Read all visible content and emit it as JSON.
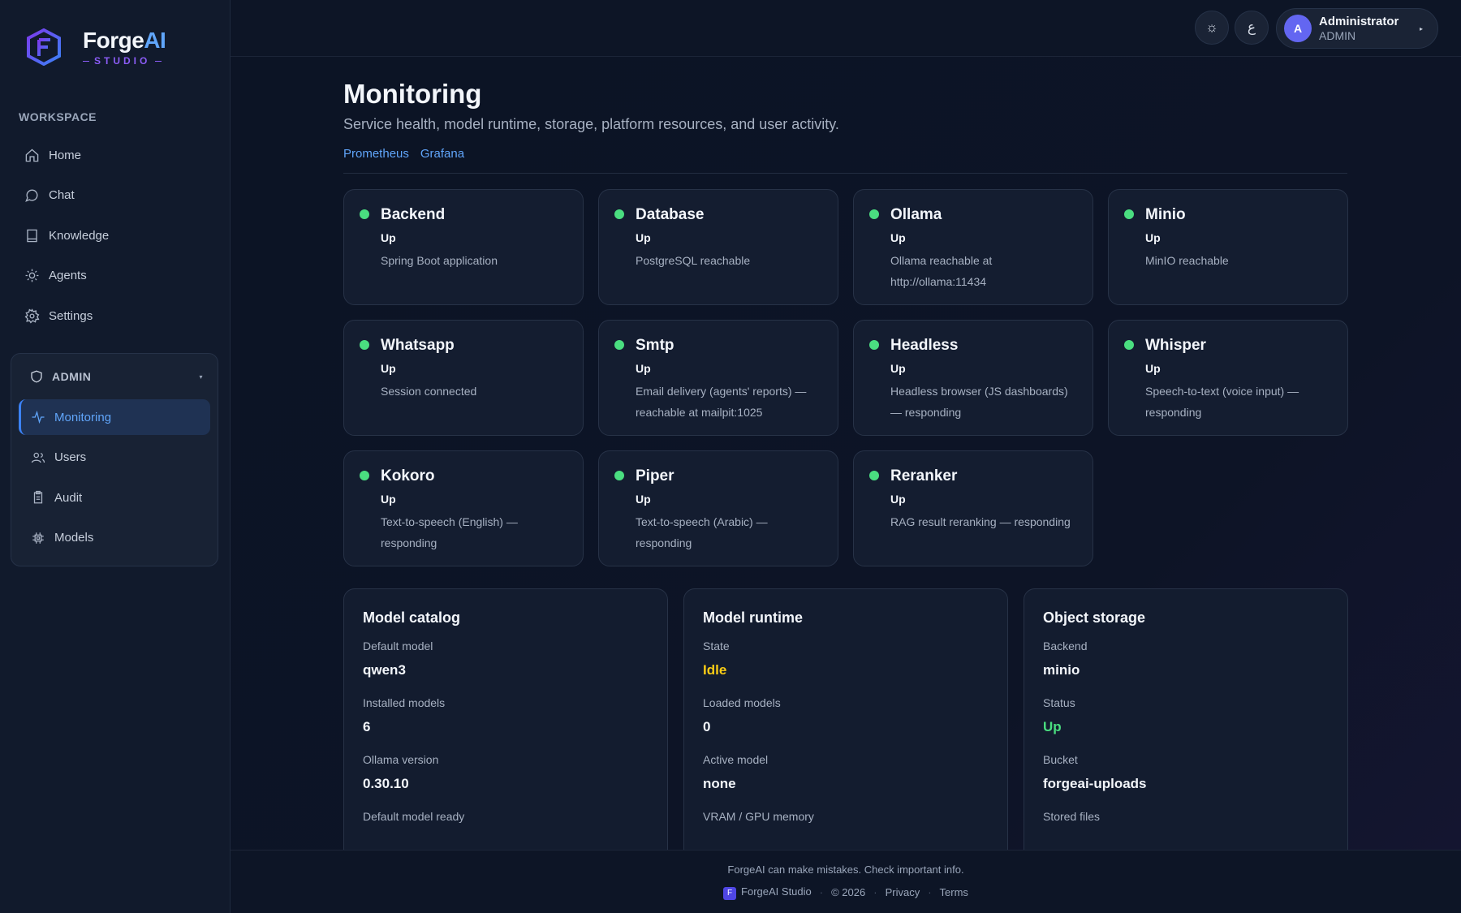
{
  "brand": {
    "name_main": "Forge",
    "name_accent": "AI",
    "subtitle": "STUDIO"
  },
  "sidebar": {
    "section_label": "WORKSPACE",
    "items": [
      {
        "label": "Home",
        "icon": "home-icon"
      },
      {
        "label": "Chat",
        "icon": "chat-icon"
      },
      {
        "label": "Knowledge",
        "icon": "book-icon"
      },
      {
        "label": "Agents",
        "icon": "sun-icon"
      },
      {
        "label": "Settings",
        "icon": "gear-icon"
      }
    ],
    "admin": {
      "label": "ADMIN",
      "items": [
        {
          "label": "Monitoring",
          "icon": "activity-icon",
          "active": true
        },
        {
          "label": "Users",
          "icon": "users-icon"
        },
        {
          "label": "Audit",
          "icon": "clipboard-icon"
        },
        {
          "label": "Models",
          "icon": "chip-icon"
        }
      ]
    }
  },
  "topbar": {
    "theme_icon": "☼",
    "language_label": "ع",
    "user": {
      "initial": "A",
      "name": "Administrator",
      "role": "ADMIN"
    }
  },
  "page": {
    "title": "Monitoring",
    "subtitle": "Service health, model runtime, storage, platform resources, and user activity.",
    "links": [
      "Prometheus",
      "Grafana"
    ]
  },
  "services": [
    {
      "name": "Backend",
      "status": "Up",
      "detail": "Spring Boot application"
    },
    {
      "name": "Database",
      "status": "Up",
      "detail": "PostgreSQL reachable"
    },
    {
      "name": "Ollama",
      "status": "Up",
      "detail": "Ollama reachable at http://ollama:11434"
    },
    {
      "name": "Minio",
      "status": "Up",
      "detail": "MinIO reachable"
    },
    {
      "name": "Whatsapp",
      "status": "Up",
      "detail": "Session connected"
    },
    {
      "name": "Smtp",
      "status": "Up",
      "detail": "Email delivery (agents' reports) — reachable at mailpit:1025"
    },
    {
      "name": "Headless",
      "status": "Up",
      "detail": "Headless browser (JS dashboards) — responding"
    },
    {
      "name": "Whisper",
      "status": "Up",
      "detail": "Speech-to-text (voice input) — responding"
    },
    {
      "name": "Kokoro",
      "status": "Up",
      "detail": "Text-to-speech (English) — responding"
    },
    {
      "name": "Piper",
      "status": "Up",
      "detail": "Text-to-speech (Arabic) — responding"
    },
    {
      "name": "Reranker",
      "status": "Up",
      "detail": "RAG result reranking — responding"
    }
  ],
  "status_color": "#4ade80",
  "model_catalog": {
    "title": "Model catalog",
    "rows": [
      {
        "label": "Default model",
        "value": "qwen3"
      },
      {
        "label": "Installed models",
        "value": "6"
      },
      {
        "label": "Ollama version",
        "value": "0.30.10"
      },
      {
        "label": "Default model ready",
        "value": ""
      }
    ]
  },
  "model_runtime": {
    "title": "Model runtime",
    "rows": [
      {
        "label": "State",
        "value": "Idle"
      },
      {
        "label": "Loaded models",
        "value": "0"
      },
      {
        "label": "Active model",
        "value": "none"
      },
      {
        "label": "VRAM / GPU memory",
        "value": ""
      }
    ]
  },
  "object_storage": {
    "title": "Object storage",
    "rows": [
      {
        "label": "Backend",
        "value": "minio"
      },
      {
        "label": "Status",
        "value": "Up"
      },
      {
        "label": "Bucket",
        "value": "forgeai-uploads"
      },
      {
        "label": "Stored files",
        "value": ""
      }
    ]
  },
  "footer": {
    "note": "ForgeAI can make mistakes. Check important info.",
    "logo_initial": "F",
    "brand": "ForgeAI Studio",
    "copyright": "© 2026",
    "privacy": "Privacy",
    "terms": "Terms"
  }
}
